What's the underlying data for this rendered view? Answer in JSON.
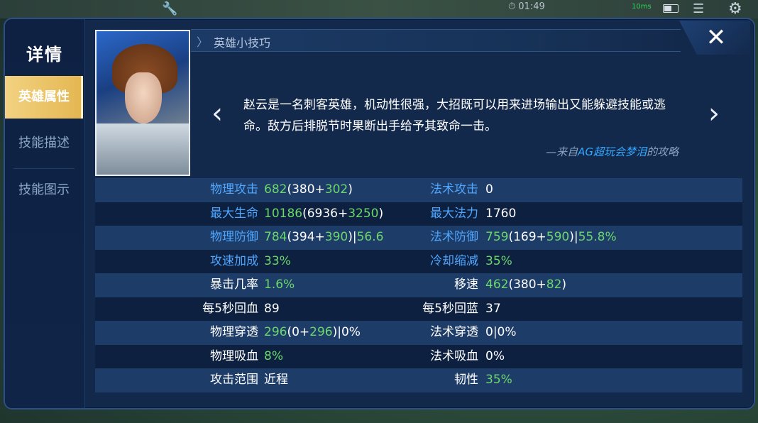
{
  "hud": {
    "time": "01:49",
    "ping": "10ms"
  },
  "sidebar": {
    "title": "详情",
    "items": [
      {
        "label": "英雄属性",
        "active": true
      },
      {
        "label": "技能描述",
        "active": false
      },
      {
        "label": "技能图示",
        "active": false
      }
    ]
  },
  "tips": {
    "header": "英雄小技巧",
    "text": "赵云是一名刺客英雄，机动性很强，大招既可以用来进场输出又能躲避技能或逃命。敌方后排脱节时果断出手给予其致命一击。",
    "source_prefix": "—来自",
    "source_author": "AG超玩会梦泪",
    "source_suffix": "的攻略"
  },
  "colors": {
    "blue_label": "#4ea6ff",
    "bonus_green": "#6cd76b",
    "active_tab": "#e4b651"
  },
  "stats": [
    {
      "l_label": "物理攻击",
      "l_label_color": "blue",
      "l_value": [
        [
          "682",
          "green"
        ],
        [
          "(380+",
          "white"
        ],
        [
          "302",
          "green"
        ],
        [
          ")",
          "white"
        ]
      ],
      "r_label": "法术攻击",
      "r_label_color": "blue",
      "r_value": [
        [
          "0",
          "white"
        ]
      ]
    },
    {
      "l_label": "最大生命",
      "l_label_color": "blue",
      "l_value": [
        [
          "10186",
          "green"
        ],
        [
          "(6936+",
          "white"
        ],
        [
          "3250",
          "green"
        ],
        [
          ")",
          "white"
        ]
      ],
      "r_label": "最大法力",
      "r_label_color": "blue",
      "r_value": [
        [
          "1760",
          "white"
        ]
      ]
    },
    {
      "l_label": "物理防御",
      "l_label_color": "blue",
      "l_value": [
        [
          "784",
          "green"
        ],
        [
          "(394+",
          "white"
        ],
        [
          "390",
          "green"
        ],
        [
          ")|",
          "white"
        ],
        [
          "56.6",
          "green"
        ]
      ],
      "r_label": "法术防御",
      "r_label_color": "blue",
      "r_value": [
        [
          "759",
          "green"
        ],
        [
          "(169+",
          "white"
        ],
        [
          "590",
          "green"
        ],
        [
          ")|",
          "white"
        ],
        [
          "55.8%",
          "green"
        ]
      ]
    },
    {
      "l_label": "攻速加成",
      "l_label_color": "blue",
      "l_value": [
        [
          "33%",
          "green"
        ]
      ],
      "r_label": "冷却缩减",
      "r_label_color": "blue",
      "r_value": [
        [
          "35%",
          "green"
        ]
      ]
    },
    {
      "l_label": "暴击几率",
      "l_label_color": "white",
      "l_value": [
        [
          "1.6%",
          "green"
        ]
      ],
      "r_label": "移速",
      "r_label_color": "white",
      "r_value": [
        [
          "462",
          "green"
        ],
        [
          "(380+",
          "white"
        ],
        [
          "82",
          "green"
        ],
        [
          ")",
          "white"
        ]
      ]
    },
    {
      "l_label": "每5秒回血",
      "l_label_color": "white",
      "l_value": [
        [
          "89",
          "white"
        ]
      ],
      "r_label": "每5秒回蓝",
      "r_label_color": "white",
      "r_value": [
        [
          "37",
          "white"
        ]
      ]
    },
    {
      "l_label": "物理穿透",
      "l_label_color": "white",
      "l_value": [
        [
          "296",
          "green"
        ],
        [
          "(0+",
          "white"
        ],
        [
          "296",
          "green"
        ],
        [
          ")|0%",
          "white"
        ]
      ],
      "r_label": "法术穿透",
      "r_label_color": "white",
      "r_value": [
        [
          "0|0%",
          "white"
        ]
      ]
    },
    {
      "l_label": "物理吸血",
      "l_label_color": "white",
      "l_value": [
        [
          "8%",
          "green"
        ]
      ],
      "r_label": "法术吸血",
      "r_label_color": "white",
      "r_value": [
        [
          "0%",
          "white"
        ]
      ]
    },
    {
      "l_label": "攻击范围",
      "l_label_color": "white",
      "l_value": [
        [
          "近程",
          "white"
        ]
      ],
      "r_label": "韧性",
      "r_label_color": "white",
      "r_value": [
        [
          "35%",
          "green"
        ]
      ]
    }
  ]
}
